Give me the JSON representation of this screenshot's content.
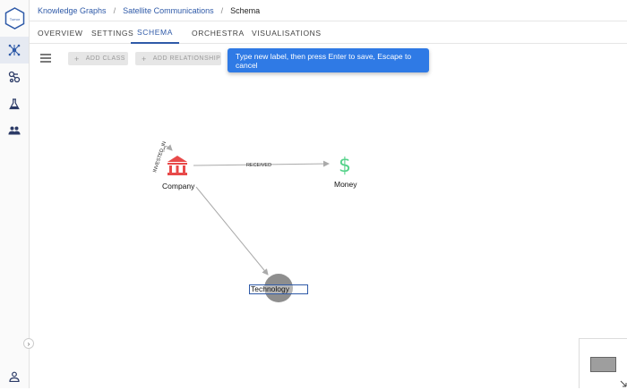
{
  "breadcrumb": {
    "root": "Knowledge Graphs",
    "parent": "Satellite Communications",
    "current": "Schema",
    "separator": "/"
  },
  "tabs": [
    {
      "label": "OVERVIEW"
    },
    {
      "label": "SETTINGS"
    },
    {
      "label": "SCHEMA"
    },
    {
      "label": "ORCHESTRA"
    },
    {
      "label": "VISUALISATIONS"
    }
  ],
  "active_tab": "SCHEMA",
  "toolbar": {
    "add_class_label": "ADD CLASS",
    "add_relationship_label": "ADD RELATIONSHIP",
    "plus": "+"
  },
  "toast": {
    "message": "Type new label, then press Enter to save, Escape to cancel"
  },
  "logo": {
    "text": "Tumor"
  },
  "expand_glyph": "›",
  "graph": {
    "nodes": [
      {
        "label": "Company",
        "icon": "bank-icon",
        "color": "#e84a4a"
      },
      {
        "label": "Money",
        "icon": "dollar-icon",
        "glyph": "$",
        "color": "#55d28a"
      },
      {
        "label": "Technology",
        "icon": "circle",
        "color": "#8e8e8e"
      }
    ],
    "edges": [
      {
        "label": "INVESTED_IN",
        "from": "Company",
        "to": "Company"
      },
      {
        "label": "RECEIVED",
        "from": "Company",
        "to": "Money"
      },
      {
        "label": "",
        "from": "Company",
        "to": "Technology"
      }
    ],
    "editing_value": "Technology"
  },
  "colors": {
    "accent": "#2f5aa8",
    "toast_bg": "#2f7ae5",
    "rail_active": "#e6eaf2"
  }
}
